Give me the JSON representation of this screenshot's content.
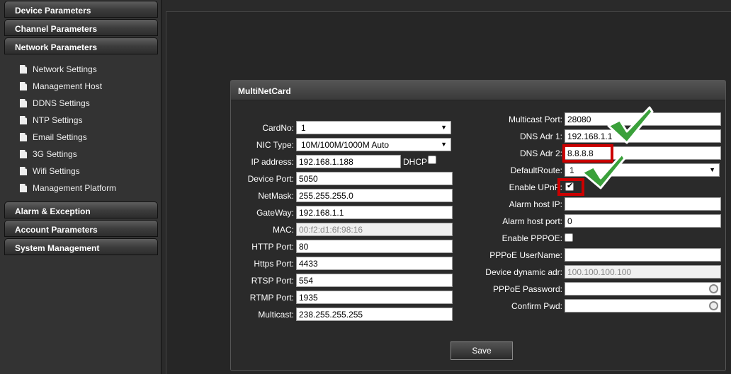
{
  "sidebar": {
    "categories": [
      {
        "label": "Device Parameters"
      },
      {
        "label": "Channel Parameters"
      },
      {
        "label": "Network Parameters"
      },
      {
        "label": "Alarm & Exception"
      },
      {
        "label": "Account Parameters"
      },
      {
        "label": "System Management"
      }
    ],
    "network_items": [
      {
        "label": "Network Settings"
      },
      {
        "label": "Management Host"
      },
      {
        "label": "DDNS Settings"
      },
      {
        "label": "NTP Settings"
      },
      {
        "label": "Email Settings"
      },
      {
        "label": "3G Settings"
      },
      {
        "label": "Wifi Settings"
      },
      {
        "label": "Management Platform"
      }
    ]
  },
  "panel": {
    "title": "MultiNetCard",
    "left": {
      "cardno": {
        "label": "CardNo:",
        "value": "1"
      },
      "nic_type": {
        "label": "NIC Type:",
        "value": "10M/100M/1000M Auto"
      },
      "ip": {
        "label": "IP address:",
        "value": "192.168.1.188",
        "dhcp_label": "DHCP"
      },
      "device_port": {
        "label": "Device Port:",
        "value": "5050"
      },
      "netmask": {
        "label": "NetMask:",
        "value": "255.255.255.0"
      },
      "gateway": {
        "label": "GateWay:",
        "value": "192.168.1.1"
      },
      "mac": {
        "label": "MAC:",
        "value": "00:f2:d1:6f:98:16"
      },
      "http_port": {
        "label": "HTTP Port:",
        "value": "80"
      },
      "https_port": {
        "label": "Https Port:",
        "value": "4433"
      },
      "rtsp_port": {
        "label": "RTSP Port:",
        "value": "554"
      },
      "rtmp_port": {
        "label": "RTMP Port:",
        "value": "1935"
      },
      "multicast": {
        "label": "Multicast:",
        "value": "238.255.255.255"
      }
    },
    "right": {
      "multicast_port": {
        "label": "Multicast Port:",
        "value": "28080"
      },
      "dns1": {
        "label": "DNS Adr 1:",
        "value": "192.168.1.1"
      },
      "dns2": {
        "label": "DNS Adr 2:",
        "value": "8.8.8.8"
      },
      "default_route": {
        "label": "DefaultRoute:",
        "value": "1"
      },
      "enable_upnp": {
        "label": "Enable UPnP:",
        "checked": true
      },
      "alarm_host_ip": {
        "label": "Alarm host IP:",
        "value": ""
      },
      "alarm_host_port": {
        "label": "Alarm host port:",
        "value": "0"
      },
      "enable_pppoe": {
        "label": "Enable PPPOE:",
        "checked": false
      },
      "pppoe_user": {
        "label": "PPPoE UserName:",
        "value": ""
      },
      "dynamic_addr": {
        "label": "Device dynamic adr:",
        "value": "100.100.100.100"
      },
      "pppoe_password": {
        "label": "PPPoE Password:",
        "value": ""
      },
      "confirm_pwd": {
        "label": "Confirm Pwd:",
        "value": ""
      }
    },
    "save_label": "Save"
  },
  "annotations": {
    "highlight_color": "#cc0000",
    "check_color": "#2d8a2d"
  }
}
